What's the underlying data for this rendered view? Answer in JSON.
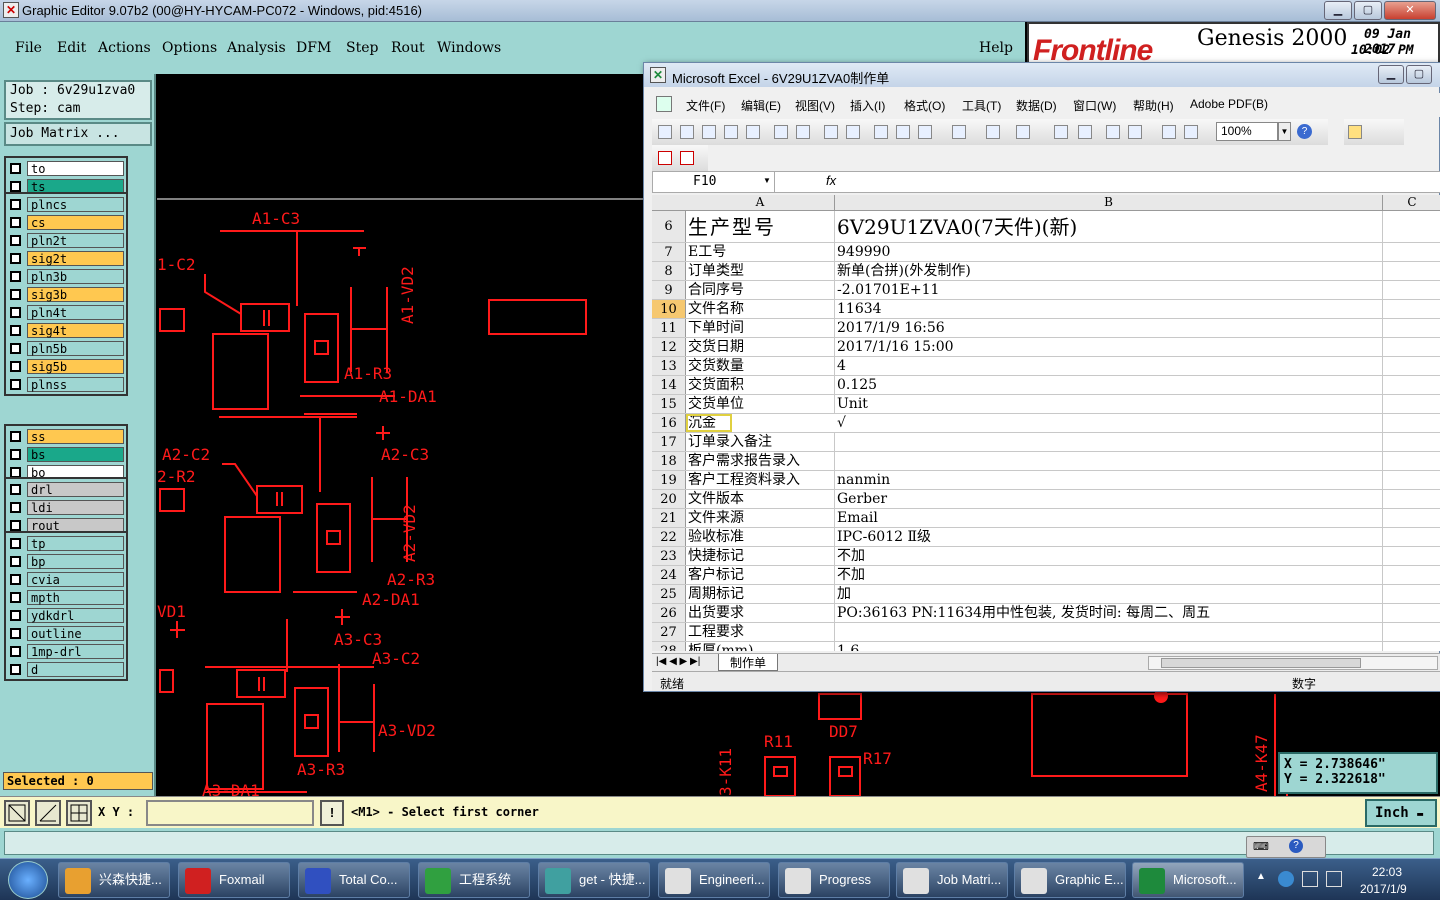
{
  "genesis": {
    "title": "Graphic Editor 9.07b2 (00@HY-HYCAM-PC072 - Windows, pid:4516)",
    "menu": [
      "File",
      "Edit",
      "Actions",
      "Options",
      "Analysis",
      "DFM",
      "Step",
      "Rout",
      "Windows"
    ],
    "help": "Help",
    "logo_text": "Frontline",
    "product": "Genesis 2000",
    "date": "09 Jan 2017",
    "time": "10:02 PM",
    "job_label": "Job : 6v29u1zva0",
    "step_label": "Step: cam",
    "job_matrix": "Job Matrix ...",
    "layers_group1": [
      {
        "name": "to",
        "color": "#ffffff"
      },
      {
        "name": "ts",
        "color": "#1aa88a"
      }
    ],
    "layers_group2": [
      {
        "name": "plncs",
        "color": "#9ed6d2"
      },
      {
        "name": "cs",
        "color": "#ffc850"
      },
      {
        "name": "pln2t",
        "color": "#9ed6d2"
      },
      {
        "name": "sig2t",
        "color": "#ffc850"
      },
      {
        "name": "pln3b",
        "color": "#9ed6d2"
      },
      {
        "name": "sig3b",
        "color": "#ffc850"
      },
      {
        "name": "pln4t",
        "color": "#9ed6d2"
      },
      {
        "name": "sig4t",
        "color": "#ffc850"
      },
      {
        "name": "pln5b",
        "color": "#9ed6d2"
      },
      {
        "name": "sig5b",
        "color": "#ffc850"
      },
      {
        "name": "plnss",
        "color": "#9ed6d2"
      }
    ],
    "layers_group3": [
      {
        "name": "ss",
        "color": "#ffc850"
      },
      {
        "name": "bs",
        "color": "#1aa88a"
      },
      {
        "name": "bo",
        "color": "#ffffff"
      }
    ],
    "layers_group4": [
      {
        "name": "drl",
        "color": "#c8c8c8"
      },
      {
        "name": "ldi",
        "color": "#c8c8c8"
      },
      {
        "name": "rout",
        "color": "#c8c8c8"
      }
    ],
    "layers_group5": [
      {
        "name": "tp",
        "color": "#9ed6d2"
      },
      {
        "name": "bp",
        "color": "#9ed6d2"
      },
      {
        "name": "cvia",
        "color": "#9ed6d2"
      },
      {
        "name": "mpth",
        "color": "#9ed6d2"
      },
      {
        "name": "ydkdrl",
        "color": "#9ed6d2"
      },
      {
        "name": "outline",
        "color": "#9ed6d2"
      },
      {
        "name": "1mp-drl",
        "color": "#9ed6d2"
      },
      {
        "name": "d",
        "color": "#9ed6d2"
      }
    ],
    "selected": "Selected : 0",
    "xy_label": "X Y :",
    "prompt": "<M1> - Select first corner",
    "units": "Inch",
    "coord_x": "X = 2.738646\"",
    "coord_y": "Y = 2.322618\"",
    "pcb_labels": {
      "a1c3": "A1-C3",
      "a1c2": "1-C2",
      "a1vd2": "A1-VD2",
      "a1r3": "A1-R3",
      "a1da1": "A1-DA1",
      "a2c2": "A2-C2",
      "a2c3": "A2-C3",
      "a2r2": "2-R2",
      "a2vd2": "A2-VD2",
      "a2r3": "A2-R3",
      "a2da1": "A2-DA1",
      "vd1": "VD1",
      "a3c3": "A3-C3",
      "a3c2": "A3-C2",
      "a3vd2": "A3-VD2",
      "a3r3": "A3-R3",
      "a3da1": "A3-DA1",
      "k11": "3-K11",
      "r11": "R11",
      "dd7": "DD7",
      "r17": "R17",
      "k47": "A4-K47"
    }
  },
  "excel": {
    "title": "Microsoft Excel - 6V29U1ZVA0制作单",
    "menu": [
      "文件(F)",
      "编辑(E)",
      "视图(V)",
      "插入(I)",
      "格式(O)",
      "工具(T)",
      "数据(D)",
      "窗口(W)",
      "帮助(H)",
      "Adobe PDF(B)"
    ],
    "zoom": "100%",
    "name_box": "F10",
    "fx": "fx",
    "col_a": "A",
    "col_b": "B",
    "col_c": "C",
    "rows": [
      {
        "n": "6",
        "a": "生产型号",
        "b": "6V29U1ZVA0(7天件)(新)"
      },
      {
        "n": "7",
        "a": "E工号",
        "b": "949990"
      },
      {
        "n": "8",
        "a": "订单类型",
        "b": "新单(合拼)(外发制作)"
      },
      {
        "n": "9",
        "a": "合同序号",
        "b": "-2.01701E+11"
      },
      {
        "n": "10",
        "a": "文件名称",
        "b": "11634"
      },
      {
        "n": "11",
        "a": "下单时间",
        "b": "2017/1/9 16:56"
      },
      {
        "n": "12",
        "a": "交货日期",
        "b": "2017/1/16 15:00"
      },
      {
        "n": "13",
        "a": "交货数量",
        "b": "4"
      },
      {
        "n": "14",
        "a": "交货面积",
        "b": "0.125"
      },
      {
        "n": "15",
        "a": "交货单位",
        "b": "Unit"
      },
      {
        "n": "16",
        "a": "沉金",
        "b": "√"
      },
      {
        "n": "17",
        "a": "订单录入备注",
        "b": ""
      },
      {
        "n": "18",
        "a": "客户需求报告录入",
        "b": ""
      },
      {
        "n": "19",
        "a": "客户工程资料录入",
        "b": "nanmin"
      },
      {
        "n": "20",
        "a": "文件版本",
        "b": "Gerber"
      },
      {
        "n": "21",
        "a": "文件来源",
        "b": "Email"
      },
      {
        "n": "22",
        "a": "验收标准",
        "b": "IPC-6012 Ⅱ级"
      },
      {
        "n": "23",
        "a": "快捷标记",
        "b": "不加"
      },
      {
        "n": "24",
        "a": "客户标记",
        "b": "不加"
      },
      {
        "n": "25",
        "a": "周期标记",
        "b": "加"
      },
      {
        "n": "26",
        "a": "出货要求",
        "b": "PO:36163 PN:11634用中性包装, 发货时间: 每周二、周五"
      },
      {
        "n": "27",
        "a": "工程要求",
        "b": ""
      },
      {
        "n": "28",
        "a": "板厚(mm)",
        "b": "1.6"
      }
    ],
    "sheet_tab": "制作单",
    "status_ready": "就绪",
    "status_num": "数字"
  },
  "taskbar": {
    "items": [
      {
        "label": "兴森快捷...",
        "color": "#e8a030"
      },
      {
        "label": "Foxmail",
        "color": "#d02020"
      },
      {
        "label": "Total Co...",
        "color": "#3050c0"
      },
      {
        "label": "工程系统",
        "color": "#30a040"
      },
      {
        "label": "get - 快捷...",
        "color": "#40a0a0"
      },
      {
        "label": "Engineeri...",
        "color": "#e0e0e0"
      },
      {
        "label": "Progress",
        "color": "#e0e0e0"
      },
      {
        "label": "Job Matri...",
        "color": "#e0e0e0"
      },
      {
        "label": "Graphic E...",
        "color": "#e0e0e0"
      },
      {
        "label": "Microsoft...",
        "color": "#1e8a3c"
      }
    ],
    "time": "22:03",
    "date": "2017/1/9"
  }
}
